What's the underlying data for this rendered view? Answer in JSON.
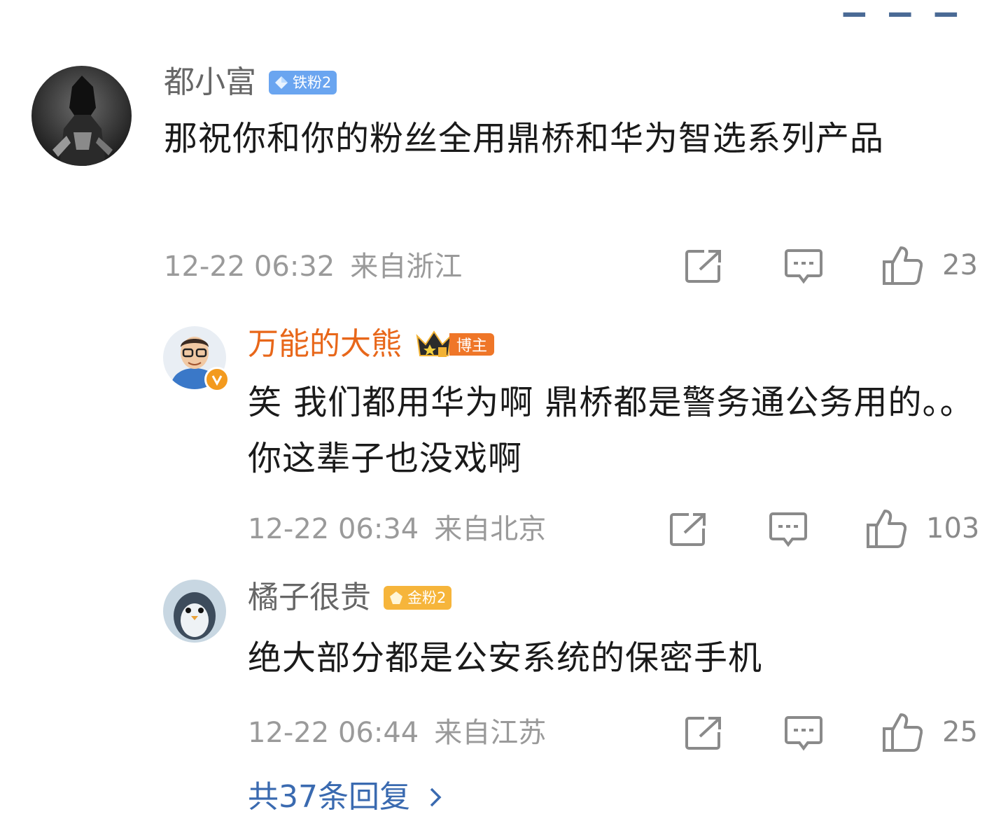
{
  "comments": [
    {
      "username": "都小富",
      "badge": "铁粉2",
      "text": "那祝你和你的粉丝全用鼎桥和华为智选系列产品",
      "time": "12-22 06:32",
      "location": "来自浙江",
      "likes": "23",
      "icons": {
        "share": "share-icon",
        "reply": "comment-icon",
        "like": "thumbs-up-icon"
      }
    },
    {
      "username": "万能的大熊",
      "badge": "博主",
      "text": "笑 我们都用华为啊 鼎桥都是警务通公务用的。。你这辈子也没戏啊",
      "time": "12-22 06:34",
      "location": "来自北京",
      "likes": "103"
    },
    {
      "username": "橘子很贵",
      "badge": "金粉2",
      "text": "绝大部分都是公安系统的保密手机",
      "time": "12-22 06:44",
      "location": "来自江苏",
      "likes": "25"
    }
  ],
  "more_replies": "共37条回复",
  "colors": {
    "host_name": "#e8671a",
    "link_blue": "#3a6ab0",
    "iron_badge": "#6aa5f0",
    "gold_badge": "#f6b53b",
    "meta_gray": "#9a9a9a"
  }
}
